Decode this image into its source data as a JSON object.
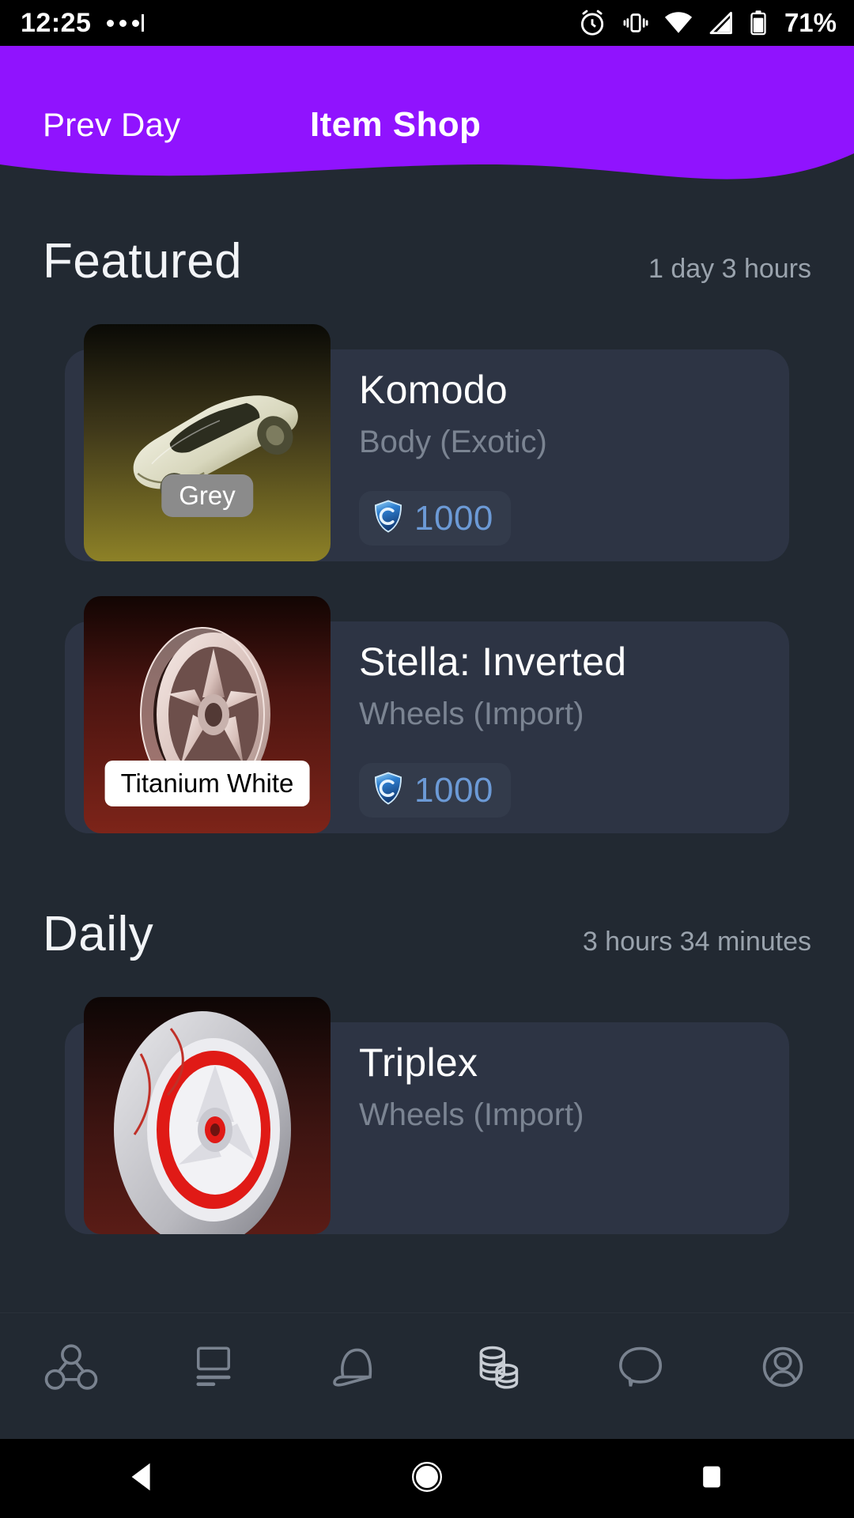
{
  "status_bar": {
    "time": "12:25",
    "battery_percent": "71%",
    "icons": [
      "notification-dots",
      "alarm-icon",
      "vibrate-icon",
      "wifi-icon",
      "cellular-icon",
      "battery-icon"
    ]
  },
  "header": {
    "back_label": "Prev Day",
    "title": "Item Shop",
    "accent_color": "#9013fe",
    "bg_color": "#222932"
  },
  "sections": [
    {
      "title": "Featured",
      "timer": "1 day 3 hours",
      "items": [
        {
          "name": "Komodo",
          "type": "Body (Exotic)",
          "paint": "Grey",
          "paint_style": "grey",
          "price": "1000",
          "currency_icon": "credits-icon",
          "art": "car-komodo"
        },
        {
          "name": "Stella: Inverted",
          "type": "Wheels (Import)",
          "paint": "Titanium White",
          "paint_style": "white",
          "price": "1000",
          "currency_icon": "credits-icon",
          "art": "wheel-stella"
        }
      ]
    },
    {
      "title": "Daily",
      "timer": "3 hours 34 minutes",
      "items": [
        {
          "name": "Triplex",
          "type": "Wheels (Import)",
          "paint": "",
          "paint_style": "none",
          "price": "",
          "currency_icon": "credits-icon",
          "art": "wheel-triplex"
        }
      ]
    }
  ],
  "bottom_nav": {
    "items": [
      {
        "name": "ranks-icon",
        "label": "Ranks",
        "active": false
      },
      {
        "name": "news-icon",
        "label": "News",
        "active": false
      },
      {
        "name": "items-icon",
        "label": "Items",
        "active": false
      },
      {
        "name": "shop-coins-icon",
        "label": "Shop",
        "active": true
      },
      {
        "name": "chat-icon",
        "label": "Chat",
        "active": false
      },
      {
        "name": "profile-icon",
        "label": "Profile",
        "active": false
      }
    ],
    "icon_color": "#79828f",
    "active_color": "#c8cdd4"
  },
  "android_nav": {
    "back": "back-triangle-icon",
    "home": "home-circle-icon",
    "recents": "recents-square-icon"
  }
}
